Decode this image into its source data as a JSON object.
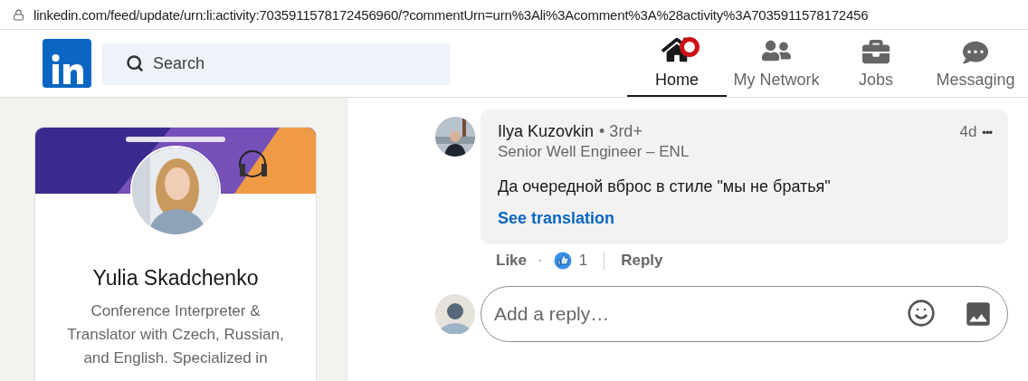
{
  "address_bar": {
    "url": "linkedin.com/feed/update/urn:li:activity:7035911578172456960/?commentUrn=urn%3Ali%3Acomment%3A%28activity%3A7035911578172456"
  },
  "nav": {
    "search": {
      "placeholder": "Search"
    },
    "items": [
      {
        "label": "Home",
        "kind": "home",
        "selected": true,
        "badge": true
      },
      {
        "label": "My Network",
        "kind": "network",
        "selected": false,
        "badge": false
      },
      {
        "label": "Jobs",
        "kind": "jobs",
        "selected": false,
        "badge": false
      },
      {
        "label": "Messaging",
        "kind": "messaging",
        "selected": false,
        "badge": false
      }
    ]
  },
  "profile_card": {
    "name": "Yulia Skadchenko",
    "headline": "Conference Interpreter & Translator with Czech, Russian, and English. Specialized in"
  },
  "comment": {
    "author": "Ilya Kuzovkin",
    "degree": "• 3rd+",
    "title": "Senior Well Engineer – ENL",
    "time": "4d",
    "more": "•••",
    "text": "Да очередной вброс в стиле \"мы не братья\"",
    "translate_link": "See translation",
    "actions": {
      "like": "Like",
      "separator": "·",
      "reaction_count": "1",
      "reply": "Reply"
    }
  },
  "reply_box": {
    "placeholder": "Add a reply…"
  }
}
